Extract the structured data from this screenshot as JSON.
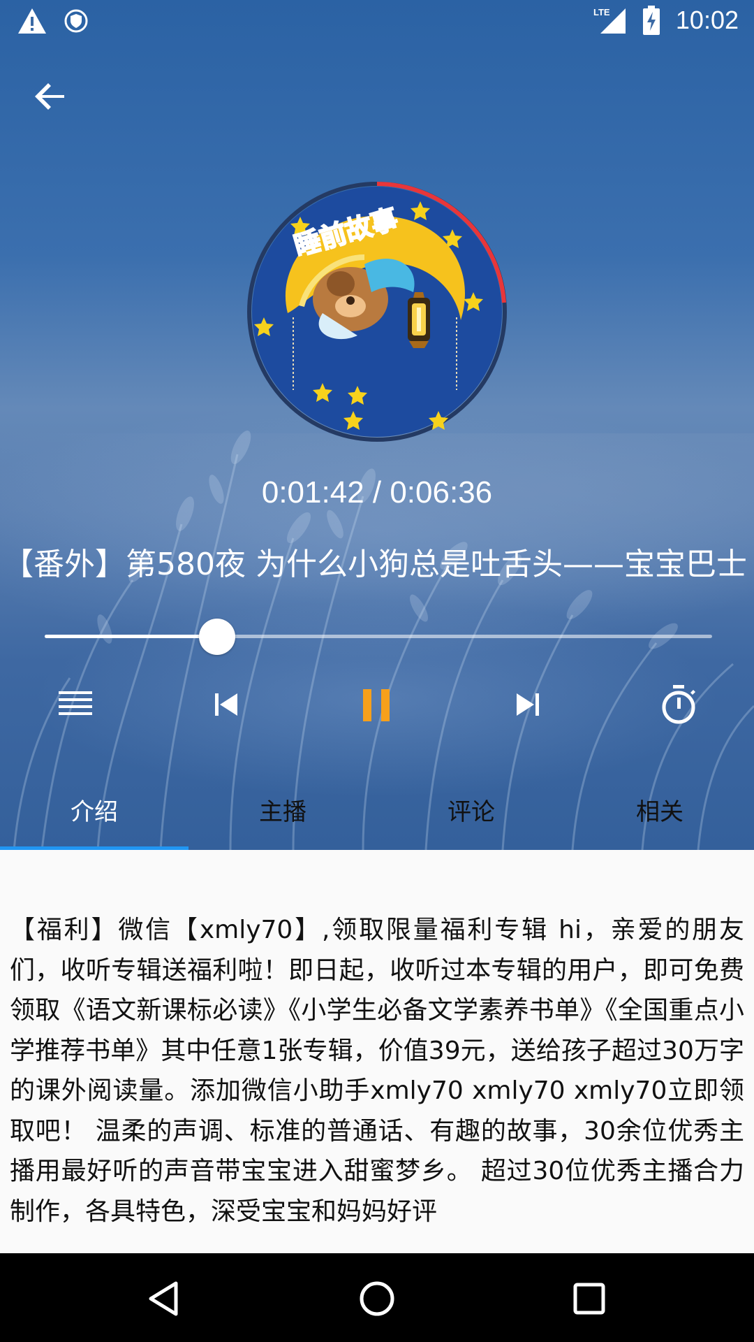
{
  "status_bar": {
    "time": "10:02",
    "network": "LTE",
    "left_icons": [
      "warning-icon",
      "shield-icon"
    ],
    "right_icons": [
      "lte-signal-icon",
      "battery-charging-icon"
    ]
  },
  "header": {
    "back_icon": "arrow-back-icon"
  },
  "player": {
    "elapsed": "0:01:42",
    "duration": "0:06:36",
    "time_display": "0:01:42 / 0:06:36",
    "progress_fraction": 0.258,
    "title": "【番外】第580夜 为什么小狗总是吐舌头——宝宝巴士",
    "album_art_text": "睡前故事",
    "controls": {
      "playlist_icon": "playlist-icon",
      "previous_icon": "skip-previous-icon",
      "pause_icon": "pause-icon",
      "next_icon": "skip-next-icon",
      "timer_icon": "timer-icon"
    },
    "accent_color": "#f7a01b",
    "ring_color": "#e8363a"
  },
  "tabs": [
    {
      "label": "介绍",
      "active": true
    },
    {
      "label": "主播",
      "active": false
    },
    {
      "label": "评论",
      "active": false
    },
    {
      "label": "相关",
      "active": false
    }
  ],
  "tab_indicator_color": "#2196f3",
  "description": "【福利】微信【xmly70】,领取限量福利专辑 hi，亲爱的朋友们，收听专辑送福利啦！即日起，收听过本专辑的用户，即可免费领取《语文新课标必读》《小学生必备文学素养书单》《全国重点小学推荐书单》其中任意1张专辑，价值39元，送给孩子超过30万字的课外阅读量。添加微信小助手xmly70 xmly70 xmly70立即领取吧！ 温柔的声调、标准的普通话、有趣的故事，30余位优秀主播用最好听的声音带宝宝进入甜蜜梦乡。 超过30位优秀主播合力制作，各具特色，深受宝宝和妈妈好评",
  "nav_bar": {
    "back_icon": "nav-back-icon",
    "home_icon": "nav-home-icon",
    "recents_icon": "nav-recents-icon"
  }
}
